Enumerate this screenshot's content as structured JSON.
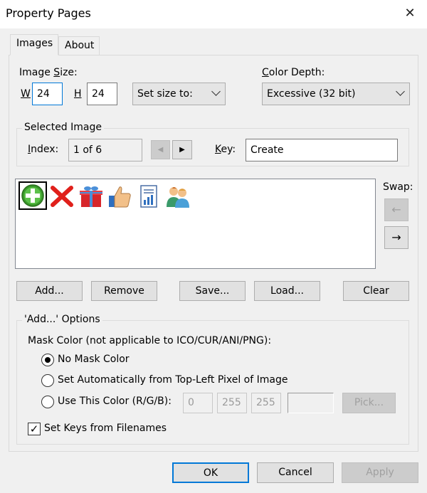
{
  "window": {
    "title": "Property Pages"
  },
  "tabs": [
    {
      "label": "Images"
    },
    {
      "label": "About"
    }
  ],
  "image_size": {
    "label_pre": "Image ",
    "label_u": "S",
    "label_post": "ize:",
    "w_label": "W",
    "w_value": "24",
    "h_label": "H",
    "h_value": "24",
    "set_size_to": "Set size to:"
  },
  "color_depth": {
    "label_u": "C",
    "label_post": "olor Depth:",
    "value": "Excessive (32 bit)"
  },
  "selected_image": {
    "legend": "Selected Image",
    "index_label_u": "I",
    "index_label_post": "ndex:",
    "index_value": "1 of 6",
    "key_label_u": "K",
    "key_label_post": "ey:",
    "key_value": "Create"
  },
  "image_list": {
    "swap_label": "Swap:",
    "icons": [
      "plus-circle-icon",
      "red-x-icon",
      "gift-icon",
      "thumbs-up-icon",
      "report-icon",
      "users-icon"
    ]
  },
  "buttons": {
    "add": "Add...",
    "remove": "Remove",
    "save": "Save...",
    "load": "Load...",
    "clear": "Clear"
  },
  "add_options": {
    "legend": "'Add...' Options",
    "mask_label": "Mask Color (not applicable to ICO/CUR/ANI/PNG):",
    "no_mask": "No Mask Color",
    "auto": "Set Automatically from Top-Left Pixel of Image",
    "use_color": "Use This Color (R/G/B):",
    "r": "0",
    "g": "255",
    "b": "255",
    "pick": "Pick...",
    "set_keys": "Set Keys from Filenames"
  },
  "footer": {
    "ok": "OK",
    "cancel": "Cancel",
    "apply": "Apply"
  },
  "colors": {
    "accent": "#0078d7",
    "background": "#f0f0f0"
  }
}
